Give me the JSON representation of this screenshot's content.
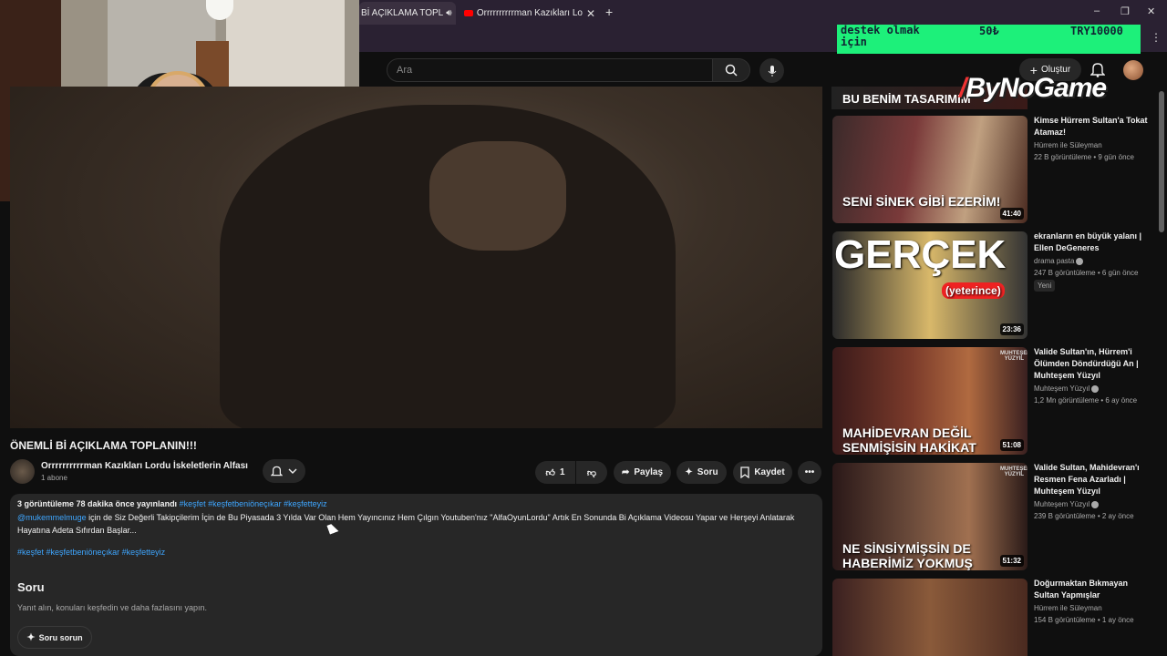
{
  "browser": {
    "tabs": [
      {
        "label": "Bİ AÇIKLAMA TOPL"
      },
      {
        "label": "Orrrrrrrrrrman Kazıkları Lordu İ"
      }
    ],
    "new_tab": "+",
    "window_controls": [
      "–",
      "❐",
      "✕"
    ]
  },
  "donation": {
    "user": "destek olmak için",
    "amount": "50₺",
    "target": "TRY10000"
  },
  "youtube_header": {
    "search_placeholder": "Ara",
    "create_label": "Oluştur"
  },
  "video": {
    "title": "ÖNEMLİ Bİ AÇIKLAMA TOPLANIN!!!",
    "channel": "Orrrrrrrrrrman Kazıkları Lordu İskeletlerin Alfası",
    "subscribers": "1 abone",
    "likes": "1",
    "share_label": "Paylaş",
    "ask_label": "Soru",
    "save_label": "Kaydet"
  },
  "description": {
    "meta": "3 görüntüleme  78 dakika önce yayınlandı",
    "meta_tags": "#keşfet #keşfetbeniöneçıkar #keşfetteyiz",
    "mention": "@mukemmelmuge",
    "text": " için de Siz Değerli Takipçilerim İçin de Bu Piyasada 3 Yılda Var Olan Hem Yayıncınız Hem Çılgın Youtuben'nız \"AlfaOyunLordu\" Artık En Sonunda Bi Açıklama Videosu Yapar ve Herşeyi Anlatarak Hayatına Adeta Sıfırdan Başlar...",
    "tags": "#keşfet #keşfetbeniöneçıkar #keşfetteyiz",
    "soru_heading": "Soru",
    "soru_sub": "Yanıt alın, konuları keşfedin ve daha fazlasını yapın.",
    "soru_button": "Soru sorun"
  },
  "sidebar": {
    "logo": "ByNoGame",
    "top_partial_caption": "BU BENİM TASARIMIM",
    "videos": [
      {
        "thumb_caption": "SENİ SİNEK GİBİ EZERİM!",
        "duration": "41:40",
        "title": "Kimse Hürrem Sultan'a Tokat Atamaz!",
        "channel": "Hürrem ile Süleyman",
        "meta": "22 B görüntüleme • 9 gün önce",
        "verified": false
      },
      {
        "thumb_caption": "GERÇEK",
        "thumb_caption2": "(yeterince)",
        "duration": "23:36",
        "title": "ekranların en büyük yalanı | Ellen DeGeneres",
        "channel": "drama pasta",
        "meta": "247 B görüntüleme • 6 gün önce",
        "verified": true,
        "badge": "Yeni"
      },
      {
        "thumb_caption": "MAHİDEVRAN DEĞİL SENMİŞİSİN HAKİKAT",
        "duration": "51:08",
        "title": "Valide Sultan'ın, Hürrem'i Ölümden Döndürdüğü An | Muhteşem Yüzyıl",
        "channel": "Muhteşem Yüzyıl",
        "meta": "1,2 Mn görüntüleme • 6 ay önce",
        "verified": true
      },
      {
        "thumb_caption": "NE SİNSİYMİŞSİN DE HABERİMİZ YOKMUŞ",
        "duration": "51:32",
        "title": "Valide Sultan, Mahidevran'ı Resmen Fena Azarladı | Muhteşem Yüzyıl",
        "channel": "Muhteşem Yüzyıl",
        "meta": "239 B görüntüleme • 2 ay önce",
        "verified": true
      },
      {
        "thumb_caption": "",
        "duration": "",
        "title": "Doğurmaktan Bıkmayan Sultan Yapmışlar",
        "channel": "Hürrem ile Süleyman",
        "meta": "154 B görüntüleme • 1 ay önce",
        "verified": false
      }
    ],
    "thumb_brand": "MUHTEŞEM YÜZYIL"
  },
  "colors": {
    "bg": "#0f0f0f",
    "link": "#3ea6ff",
    "donation": "#1df07a",
    "surface": "#272727"
  }
}
